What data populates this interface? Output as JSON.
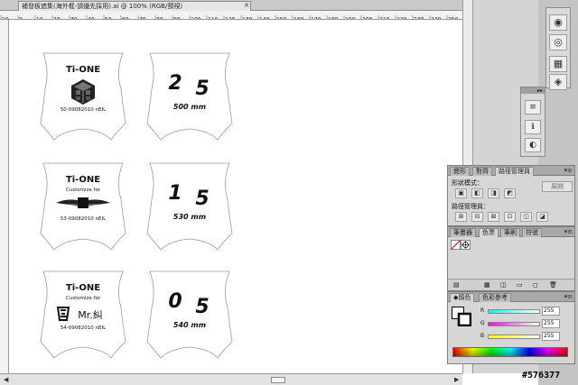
{
  "document": {
    "tab_title": "補發板遮集(海外框-請優先採用).ai @ 100% (RGB/預視)",
    "close_glyph": "×"
  },
  "ruler": {
    "marks": [
      "10",
      "0",
      "10",
      "20",
      "30",
      "40",
      "50",
      "60",
      "70",
      "80",
      "90",
      "100",
      "110",
      "120",
      "130",
      "140",
      "150",
      "160",
      "170",
      "180",
      "190",
      "200",
      "210",
      "220",
      "230",
      "240",
      "250"
    ]
  },
  "tags": [
    {
      "brand": "Ti-ONE",
      "subtitle": "",
      "icon": "cube-logo-icon",
      "code": "50-09082010 nEIL"
    },
    {
      "big_left": "2",
      "big_right": "5",
      "size_label": "500 mm"
    },
    {
      "brand": "Ti-ONE",
      "subtitle": "Customize for",
      "icon": "winged-emblem-icon",
      "code": "53-09082010 nEIL"
    },
    {
      "big_left": "1",
      "big_right": "5",
      "size_label": "530 mm"
    },
    {
      "brand": "Ti-ONE",
      "subtitle": "Customize for",
      "icon": "calligraphy-seal-icon",
      "customer": "Mr.糾",
      "code": "54-09082010 nEIL"
    },
    {
      "big_left": "0",
      "big_right": "5",
      "size_label": "540 mm"
    }
  ],
  "pathfinder_panel": {
    "tabs": [
      "變形",
      "對齊",
      "路徑管理員"
    ],
    "active_tab": "路徑管理員",
    "shape_modes_label": "形狀模式：",
    "pathfinders_label": "路徑管理員：",
    "expand_label": "展開",
    "menu_glyph": "▾≡"
  },
  "swatches_panel": {
    "tabs": [
      "筆畫器",
      "色票",
      "筆刷",
      "符號"
    ],
    "active_tab": "色票",
    "menu_glyph": "▾≡"
  },
  "color_panel": {
    "tabs": [
      "◆顏色",
      "色彩參考"
    ],
    "active_tab": "◆顏色",
    "menu_glyph": "▾≡",
    "channels": [
      {
        "name": "R",
        "value": "255"
      },
      {
        "name": "G",
        "value": "255"
      },
      {
        "name": "B",
        "value": "255"
      }
    ]
  },
  "watermark": "#576377",
  "colors": {
    "panel": "#d6d6d6",
    "panel_tab": "#a9a9a9",
    "ruler": "#f2f2f2",
    "canvas": "#ffffff"
  }
}
